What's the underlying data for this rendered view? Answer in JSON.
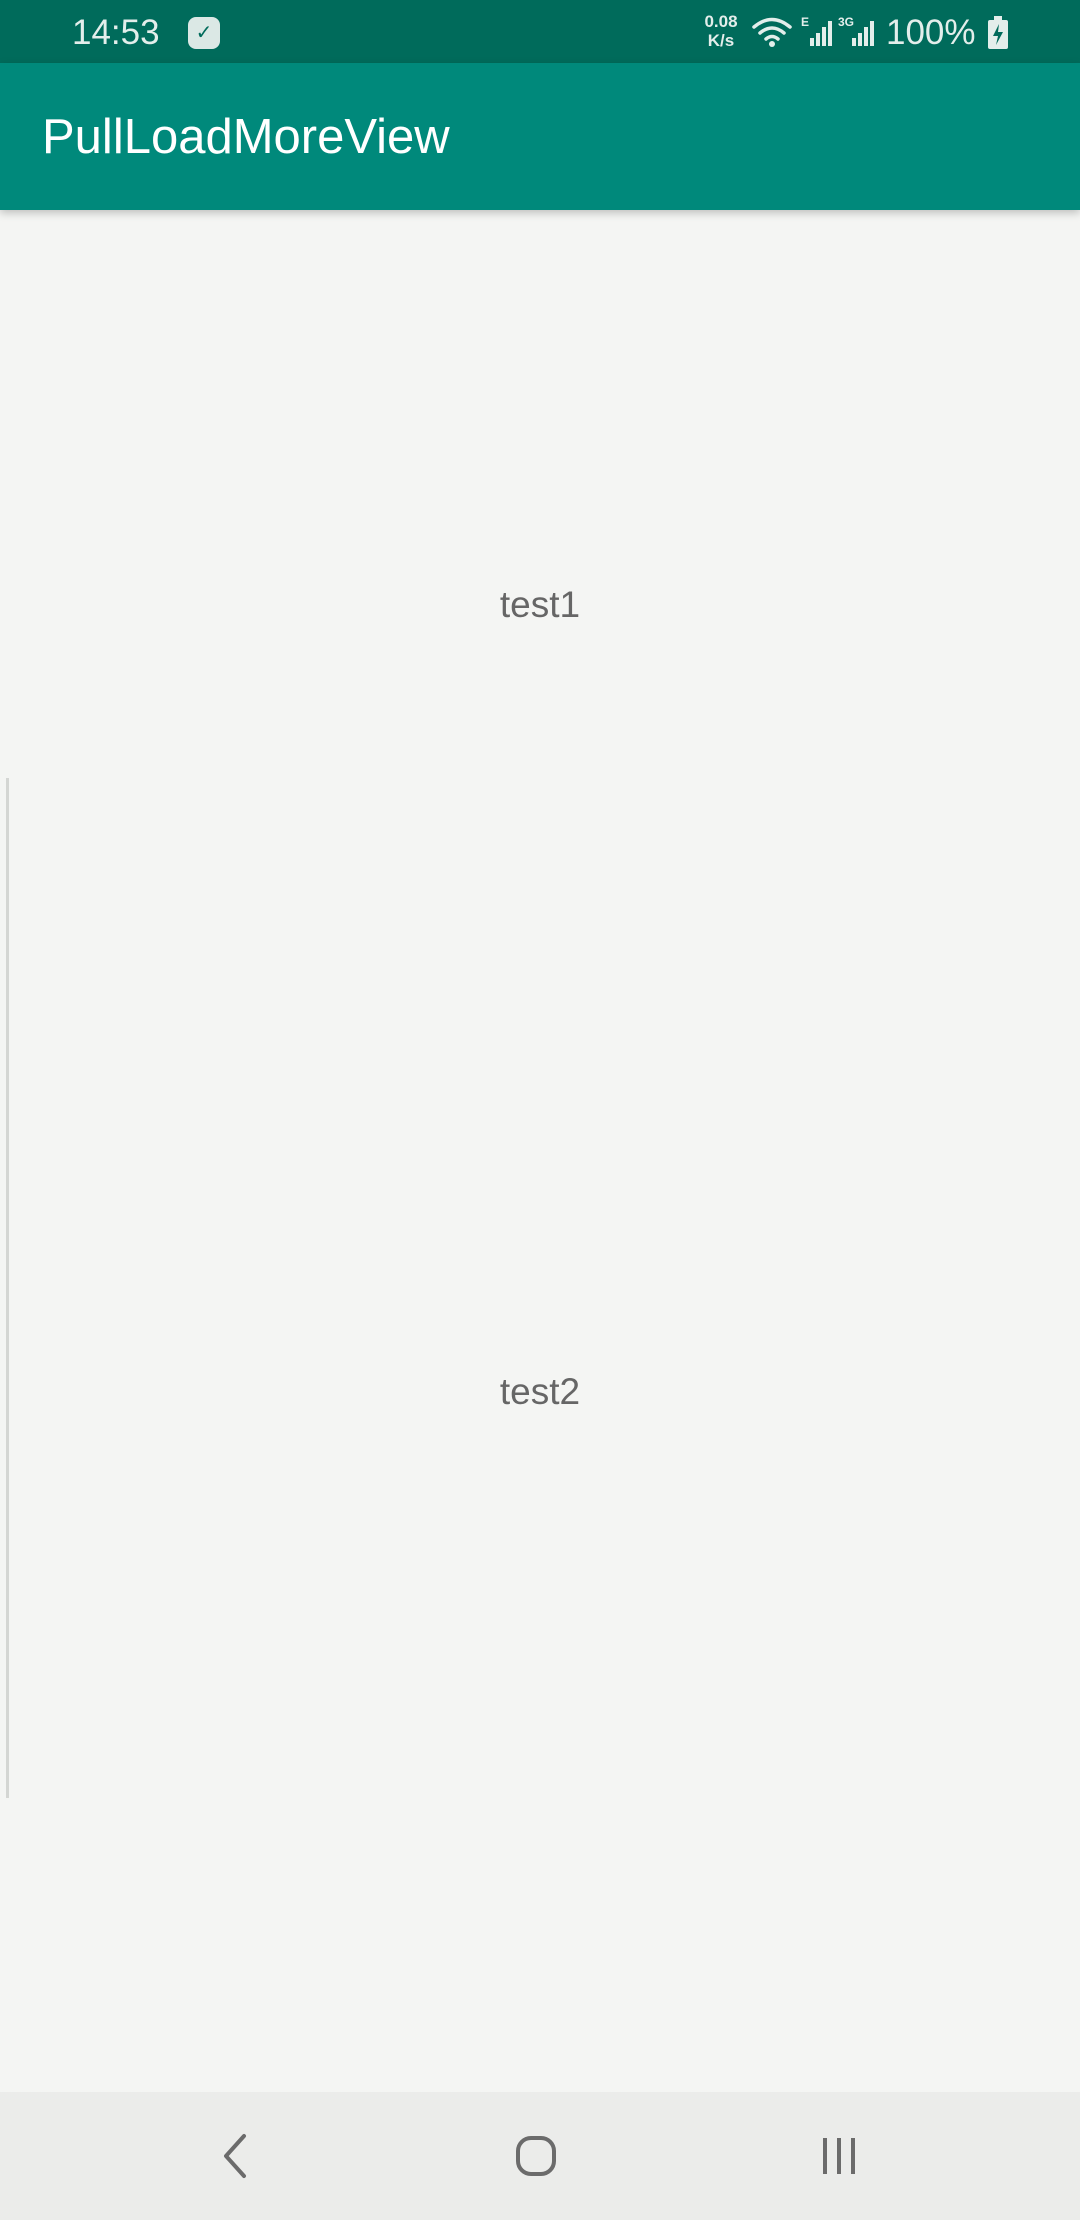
{
  "status_bar": {
    "time": "14:53",
    "net_speed_value": "0.08",
    "net_speed_unit": "K/s",
    "signal1_label": "E",
    "signal2_label": "3G",
    "battery": "100%",
    "icons": [
      "notification-app-icon",
      "wifi-icon",
      "signal-icon",
      "battery-charging-icon"
    ]
  },
  "app_bar": {
    "title": "PullLoadMoreView",
    "color": "#00897b"
  },
  "list": {
    "items": [
      "test1",
      "test2"
    ]
  },
  "nav_bar": {
    "icons": [
      "back-icon",
      "home-icon",
      "recents-icon"
    ]
  }
}
